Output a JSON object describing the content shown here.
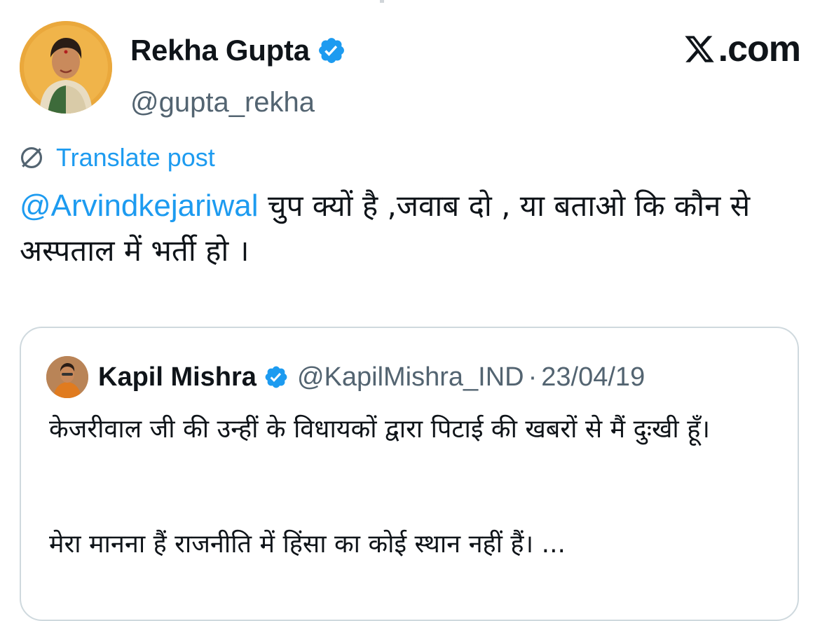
{
  "author": {
    "name": "Rekha Gupta",
    "handle": "@gupta_rekha"
  },
  "brand": {
    "text": ".com",
    "icon": "x-logo-icon"
  },
  "translate": {
    "label": "Translate post",
    "icon": "translate-globe-icon"
  },
  "post": {
    "mention": "@Arvindkejariwal",
    "text": " चुप क्यों है ,जवाब दो , या बताओ कि कौन से अस्पताल में भर्ती हो ।"
  },
  "quoted": {
    "name": "Kapil Mishra",
    "handle": "@KapilMishra_IND",
    "separator": "·",
    "date": "23/04/19",
    "text_line1": "केजरीवाल जी की उन्हीं के विधायकों द्वारा पिटाई की खबरों से मैं दुःखी हूँ।",
    "text_line2": "मेरा मानना हैं राजनीति में हिंसा का कोई स्थान नहीं हैं। ..."
  },
  "colors": {
    "accent": "#1d9bf0",
    "secondary_text": "#536471",
    "border": "#cfd9de"
  }
}
